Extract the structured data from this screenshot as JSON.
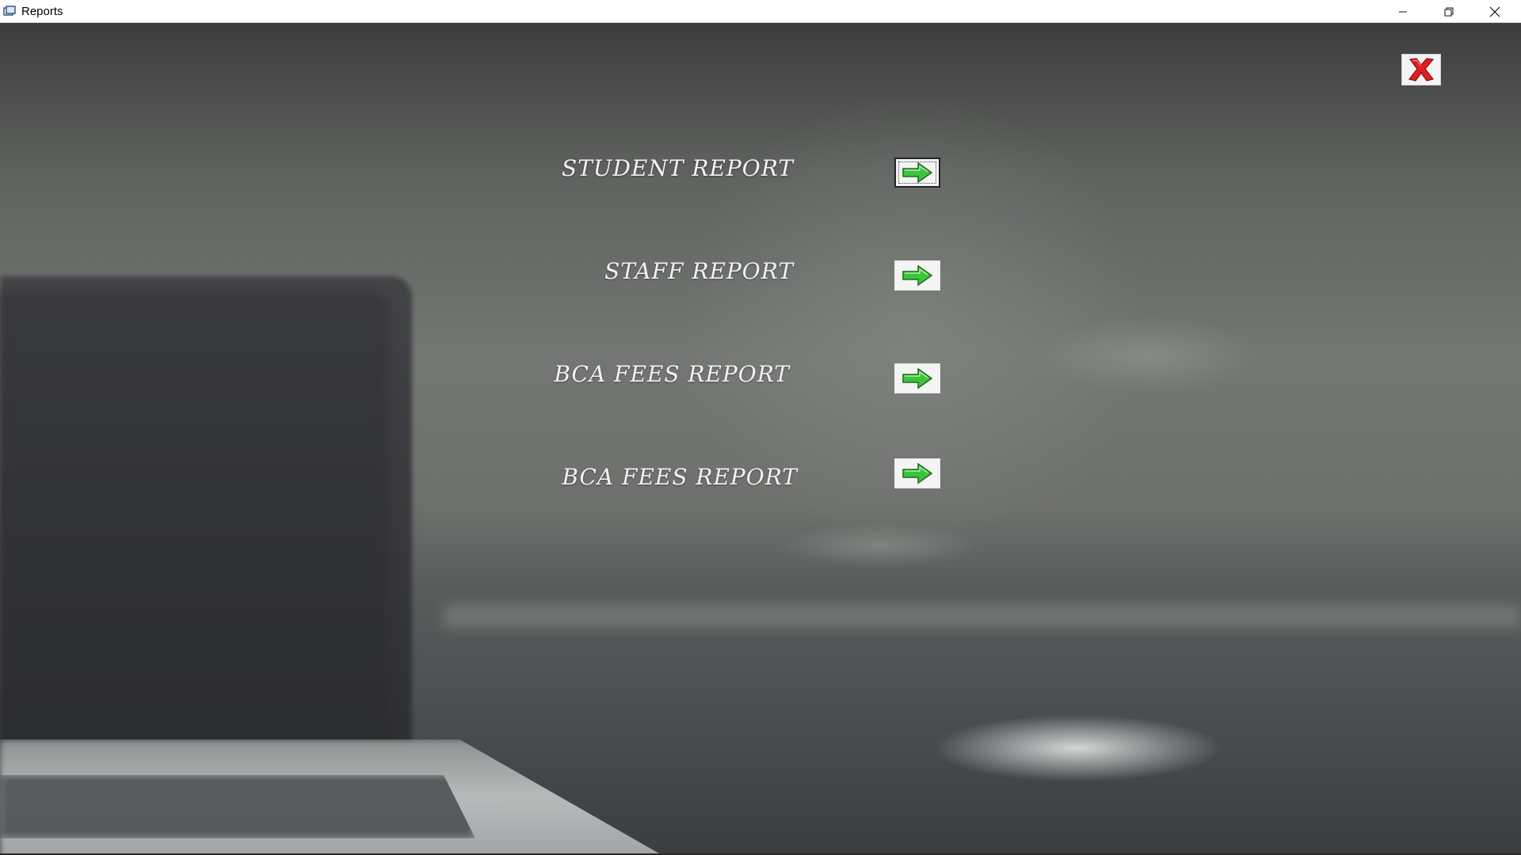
{
  "window": {
    "title": "Reports",
    "icon": "app-window-icon",
    "controls": [
      "minimize-icon",
      "restore-icon",
      "close-icon"
    ]
  },
  "exit_button": {
    "icon": "red-x-icon",
    "color": "#e02020"
  },
  "reports": [
    {
      "label": "STUDENT REPORT",
      "button_icon": "green-arrow-right-icon",
      "focused": true
    },
    {
      "label": "STAFF REPORT",
      "button_icon": "green-arrow-right-icon",
      "focused": false
    },
    {
      "label": "BCA FEES REPORT",
      "button_icon": "green-arrow-right-icon",
      "focused": false
    },
    {
      "label": "BCA FEES REPORT",
      "button_icon": "green-arrow-right-icon",
      "focused": false
    }
  ],
  "colors": {
    "arrow_fill": "#3cc43c",
    "label_text": "#f2f2f2"
  }
}
